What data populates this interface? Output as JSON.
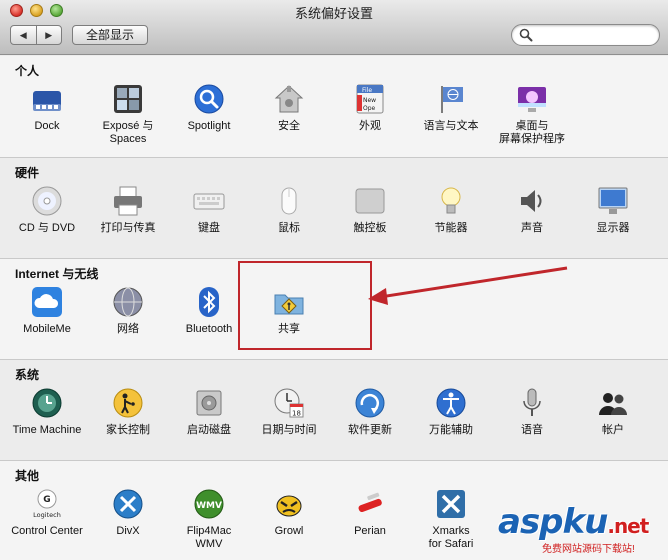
{
  "window": {
    "title": "系统偏好设置",
    "back_symbol": "◀",
    "forward_symbol": "▶",
    "show_all_label": "全部显示",
    "search_placeholder": "",
    "search_icon": "magnifier-icon"
  },
  "sections": [
    {
      "title": "个人",
      "items": [
        {
          "label": "Dock",
          "icon": "dock-icon"
        },
        {
          "label": "Exposé 与 Spaces",
          "icon": "expose-spaces-icon"
        },
        {
          "label": "Spotlight",
          "icon": "spotlight-icon"
        },
        {
          "label": "安全",
          "icon": "security-house-icon"
        },
        {
          "label": "外观",
          "icon": "appearance-icon",
          "icon_texts": [
            "File",
            "New",
            "Ope"
          ]
        },
        {
          "label": "语言与文本",
          "icon": "flag-globe-icon"
        },
        {
          "label": "桌面与 屏幕保护程序",
          "icon": "desktop-screensaver-icon"
        }
      ]
    },
    {
      "title": "硬件",
      "items": [
        {
          "label": "CD 与 DVD",
          "icon": "cd-dvd-icon"
        },
        {
          "label": "打印与传真",
          "icon": "printer-icon"
        },
        {
          "label": "键盘",
          "icon": "keyboard-icon"
        },
        {
          "label": "鼠标",
          "icon": "mouse-icon"
        },
        {
          "label": "触控板",
          "icon": "trackpad-icon"
        },
        {
          "label": "节能器",
          "icon": "lightbulb-icon"
        },
        {
          "label": "声音",
          "icon": "speaker-icon"
        },
        {
          "label": "显示器",
          "icon": "display-icon"
        }
      ]
    },
    {
      "title": "Internet 与无线",
      "items": [
        {
          "label": "MobileMe",
          "icon": "cloud-icon"
        },
        {
          "label": "网络",
          "icon": "network-globe-icon"
        },
        {
          "label": "Bluetooth",
          "icon": "bluetooth-icon"
        },
        {
          "label": "共享",
          "icon": "sharing-folder-icon"
        }
      ]
    },
    {
      "title": "系统",
      "items": [
        {
          "label": "Time Machine",
          "icon": "time-machine-icon"
        },
        {
          "label": "家长控制",
          "icon": "parental-controls-icon"
        },
        {
          "label": "启动磁盘",
          "icon": "startup-disk-icon"
        },
        {
          "label": "日期与时间",
          "icon": "clock-calendar-icon",
          "icon_texts": [
            "18"
          ]
        },
        {
          "label": "软件更新",
          "icon": "software-update-icon"
        },
        {
          "label": "万能辅助",
          "icon": "universal-access-icon"
        },
        {
          "label": "语音",
          "icon": "microphone-icon"
        },
        {
          "label": "帐户",
          "icon": "accounts-icon"
        }
      ]
    },
    {
      "title": "其他",
      "items": [
        {
          "label": "Control Center",
          "icon": "logitech-icon",
          "icon_texts": [
            "Logitech"
          ]
        },
        {
          "label": "DivX",
          "icon": "divx-icon"
        },
        {
          "label": "Flip4Mac WMV",
          "icon": "wmv-icon",
          "icon_texts": [
            "WMV"
          ]
        },
        {
          "label": "Growl",
          "icon": "growl-icon"
        },
        {
          "label": "Perian",
          "icon": "perian-knife-icon"
        },
        {
          "label": "Xmarks for Safari",
          "icon": "xmarks-icon"
        }
      ]
    }
  ],
  "annotation": {
    "highlight_color": "#c0262b"
  },
  "watermark": {
    "logo": "aspku",
    "logo_suffix": ".net",
    "subtitle": "免费网站源码下载站!"
  }
}
